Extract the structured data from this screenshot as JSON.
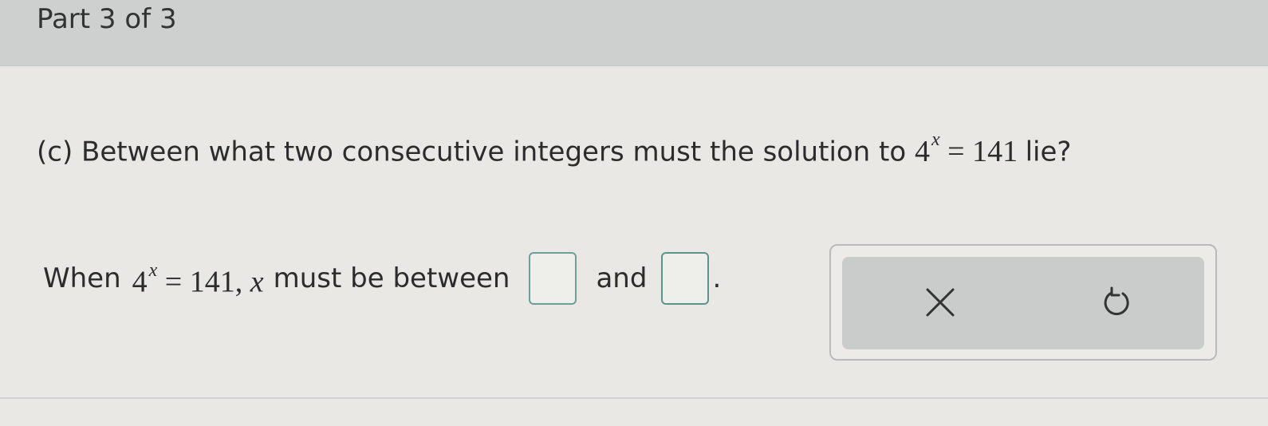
{
  "header": {
    "part_label": "Part 3 of 3"
  },
  "question": {
    "prefix": "(c) Between what two consecutive integers must the solution to",
    "base": "4",
    "exponent": "x",
    "equation_rest": "= 141",
    "suffix": "lie?"
  },
  "answer": {
    "lead": "When",
    "base": "4",
    "exponent": "x",
    "equation_rest": "= 141,",
    "variable": "x",
    "middle": "must be between",
    "conjunction": "and",
    "end": ".",
    "first_value": "",
    "second_value": ""
  },
  "tools": {
    "clear_icon": "close-icon",
    "undo_icon": "undo-icon"
  }
}
